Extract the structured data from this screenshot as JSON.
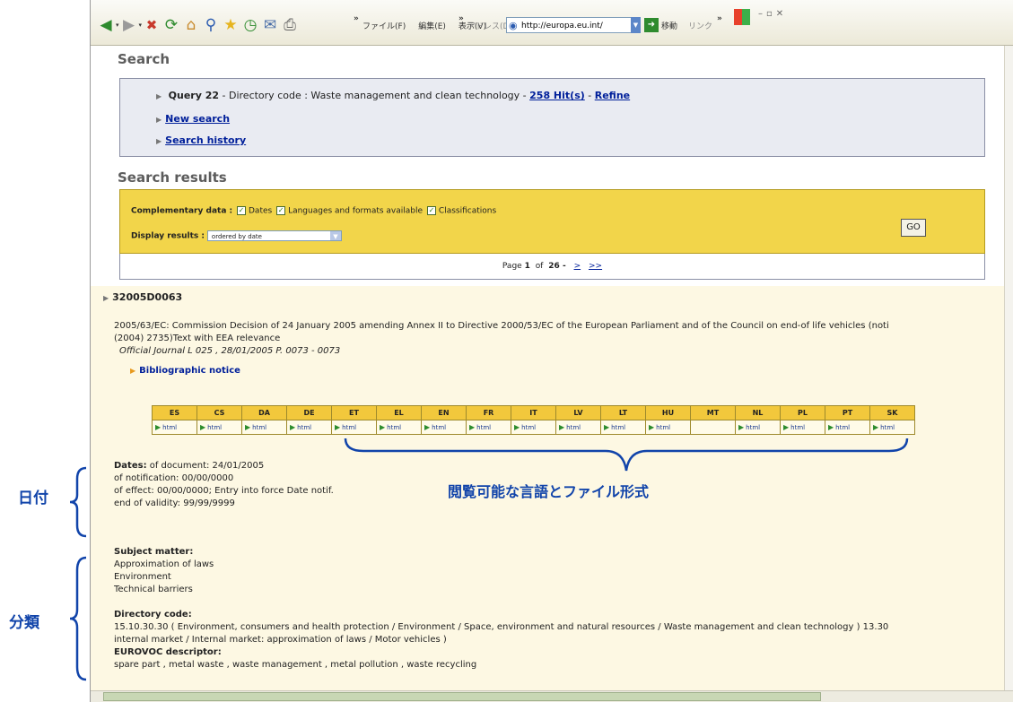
{
  "browser": {
    "menus": [
      "ファイル(F)",
      "編集(E)",
      "表示(V)"
    ],
    "address_label": "アドレス(D)",
    "address_value": "http://europa.eu.int/",
    "go_label": "移動",
    "links_label": "リンク",
    "chevron": "»"
  },
  "search": {
    "title": "Search",
    "query_label": "Query 22",
    "query_text": " - Directory code : Waste management and clean technology - ",
    "hits_link": "258 Hit(s)",
    "hits_sep": " - ",
    "refine_link": "Refine",
    "new_search": "New search",
    "search_history": "Search history"
  },
  "results": {
    "title": "Search results",
    "complementary_label": "Complementary data :",
    "options": [
      "Dates",
      "Languages and formats available",
      "Classifications"
    ],
    "display_label": "Display results :",
    "display_value": "ordered by date",
    "go_button": "GO",
    "page_prefix": "Page",
    "page_current": "1",
    "page_of": "of",
    "page_total": "26 -",
    "next": ">",
    "last": ">>"
  },
  "document": {
    "id": "32005D0063",
    "title_line1": "2005/63/EC: Commission Decision of 24 January 2005 amending Annex II to Directive 2000/53/EC of the European Parliament and of the Council on end-of life vehicles (noti",
    "title_line2": "(2004) 2735)Text with EEA relevance",
    "journal": "Official Journal L 025 , 28/01/2005 P. 0073 - 0073",
    "bib_notice": "Bibliographic notice",
    "languages": [
      "ES",
      "CS",
      "DA",
      "DE",
      "ET",
      "EL",
      "EN",
      "FR",
      "IT",
      "LV",
      "LT",
      "HU",
      "MT",
      "NL",
      "PL",
      "PT",
      "SK"
    ],
    "format_label": "html",
    "mt_format": "",
    "dates_label": "Dates:",
    "dates_doc": " of document: 24/01/2005",
    "dates_notif": "of notification: 00/00/0000",
    "dates_effect": "of effect: 00/00/0000; Entry into force Date notif.",
    "dates_end": "end of validity: 99/99/9999",
    "subject_label": "Subject matter:",
    "subjects": [
      "Approximation of laws",
      "Environment",
      "Technical barriers"
    ],
    "directory_label": "Directory code:",
    "directory_line1": "15.10.30.30 ( Environment, consumers and health protection / Environment / Space, environment and natural resources / Waste management and clean technology ) 13.30",
    "directory_line2": "internal market / Internal market: approximation of laws / Motor vehicles )",
    "eurovoc_label": "EUROVOC descriptor:",
    "eurovoc_text": "spare part , metal waste , waste management , metal pollution , waste recycling"
  },
  "annotations": {
    "dates": "日付",
    "classification": "分類",
    "languages": "閲覧可能な言語とファイル形式"
  },
  "colors": {
    "accent_yellow": "#f2d54a",
    "annotation_blue": "#1144aa",
    "link_blue": "#001f9a"
  }
}
